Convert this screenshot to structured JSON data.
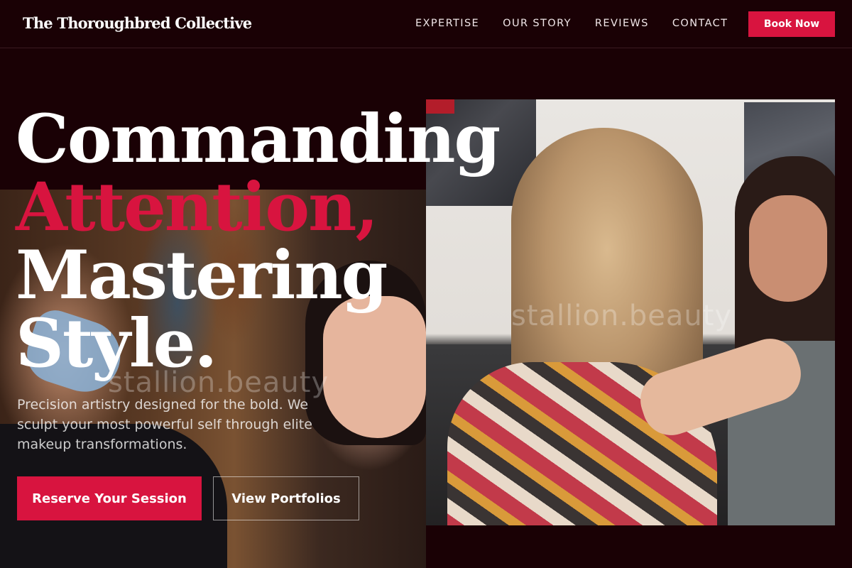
{
  "header": {
    "brand": "The Thoroughbred Collective",
    "nav": [
      "EXPERTISE",
      "OUR STORY",
      "REVIEWS",
      "CONTACT"
    ],
    "cta": "Book Now"
  },
  "hero": {
    "line1": "Commanding",
    "line2": "Attention,",
    "line3": "Mastering",
    "line4": "Style.",
    "subtext": "Precision artistry designed for the bold. We sculpt your most powerful self through elite makeup transformations.",
    "primary_button": "Reserve Your Session",
    "secondary_button": "View Portfolios"
  },
  "watermark": "stallion.beauty",
  "colors": {
    "background": "#1a0105",
    "accent": "#d8143f",
    "text": "#ffffff"
  }
}
